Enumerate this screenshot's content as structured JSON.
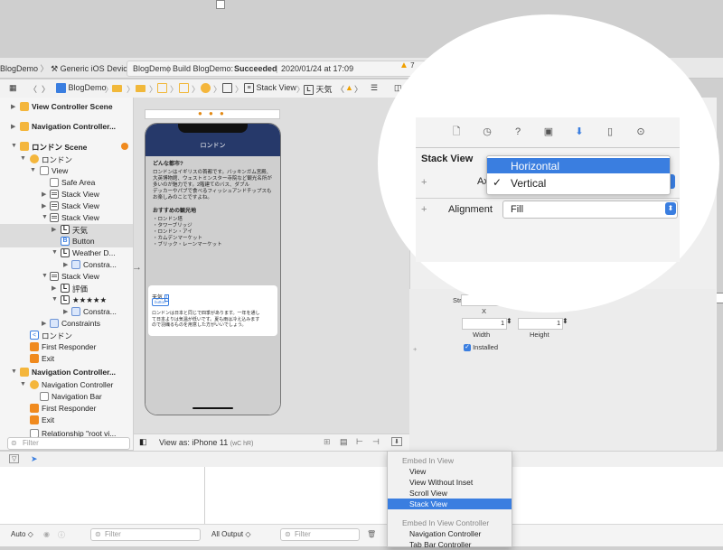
{
  "toolbar": {
    "scheme": "BlogDemo",
    "device": "Generic iOS Device",
    "status_project": "BlogDemo",
    "status_build": "Build BlogDemo:",
    "status_result": "Succeeded",
    "status_date": "2020/01/24 at 17:09",
    "warning_count": "7"
  },
  "jumpbar": {
    "project": "BlogDemo",
    "crumb_stack": "Stack View",
    "crumb_label": "天気"
  },
  "navigator": {
    "rows": [
      {
        "label": "View Controller Scene",
        "bold": true
      },
      {
        "label": "Navigation Controller...",
        "bold": true
      },
      {
        "label": "ロンドン Scene",
        "bold": true
      },
      {
        "label": "ロンドン"
      },
      {
        "label": "View"
      },
      {
        "label": "Safe Area"
      },
      {
        "label": "Stack View"
      },
      {
        "label": "Stack View"
      },
      {
        "label": "Stack View"
      },
      {
        "label": "天気"
      },
      {
        "label": "Button"
      },
      {
        "label": "Weather D..."
      },
      {
        "label": "Constra..."
      },
      {
        "label": "Stack View"
      },
      {
        "label": "評価"
      },
      {
        "label": "★★★★★"
      },
      {
        "label": "Constra..."
      },
      {
        "label": "Constraints"
      },
      {
        "label": "ロンドン"
      },
      {
        "label": "First Responder"
      },
      {
        "label": "Exit"
      },
      {
        "label": "Navigation Controller...",
        "bold": true
      },
      {
        "label": "Navigation Controller"
      },
      {
        "label": "Navigation Bar"
      },
      {
        "label": "First Responder"
      },
      {
        "label": "Exit"
      },
      {
        "label": "Relationship \"root vi..."
      }
    ],
    "filter_placeholder": "Filter"
  },
  "phone": {
    "title": "ロンドン",
    "h1": "どんな都市?",
    "p1": "ロンドンはイギリスの首都です。バッキンガム宮殿、\n大英博物館、ウェストミンスター寺院など観光名所が\n多いのが魅力です。2階建てのバス、ダブル\nデッカーやパブで食べるフィッシュアンドチップスも\nお楽しみのことですよね。",
    "h2": "おすすめの観光地",
    "list": "・ロンドン塔\n・タワーブリッジ\n・ロンドン・アイ\n・カムデンマーケット\n・ブリック・レーンマーケット",
    "card_label": "天気",
    "card_button": "button",
    "card_text": "ロンドンは日本と同じで四季があります。一年を通し\nて日本よりは気温が低いです。夏も雨は冷え込みます\nので羽織るものを用意した方がいいでしょう。"
  },
  "canvas": {
    "view_as": "View as: iPhone 11",
    "view_as_suffix": "(wC hR)"
  },
  "inspector": {
    "section_title": "Stack View",
    "axis_label": "Axis",
    "alignment_label": "Alignment",
    "alignment_value": "Fill",
    "axis_options": [
      "Horizontal",
      "Vertical"
    ],
    "axis_highlighted": "Horizontal",
    "axis_checked": "Vertical",
    "stretching_label": "Stretching",
    "x_label": "X",
    "width_value": "1",
    "height_value": "1",
    "width_label": "Width",
    "height_label": "Height",
    "installed_label": "Installed"
  },
  "embed_menu": {
    "header1": "Embed In View",
    "items1": [
      "View",
      "View Without Inset",
      "Scroll View",
      "Stack View"
    ],
    "selected": "Stack View",
    "header2": "Embed In View Controller",
    "items2": [
      "Navigation Controller",
      "Tab Bar Controller"
    ]
  },
  "debug": {
    "auto_label": "Auto ◇",
    "filter_placeholder": "Filter",
    "output_label": "All Output ◇"
  },
  "colors": {
    "accent": "#3a7ee0",
    "nav_bar": "#26396a",
    "warning": "#f0a000"
  }
}
